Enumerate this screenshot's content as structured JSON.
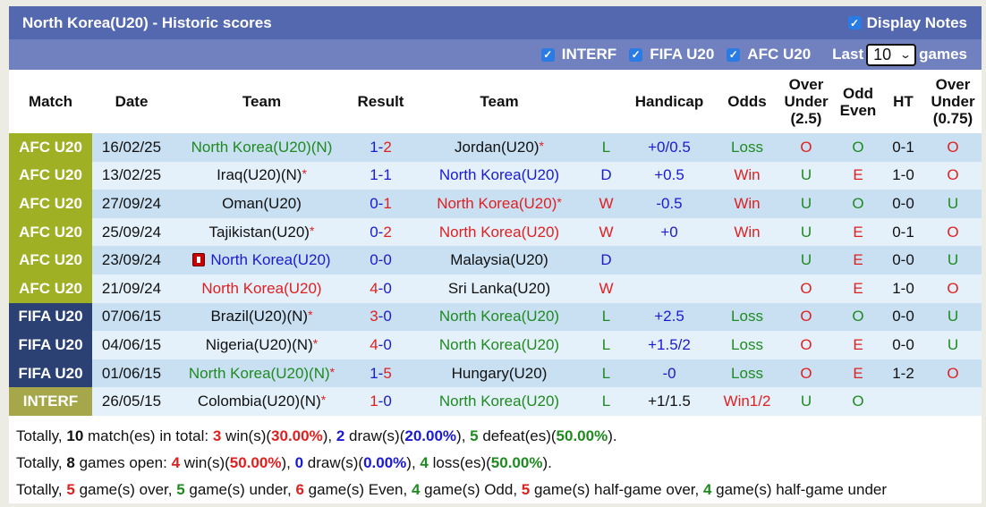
{
  "header": {
    "title": "North Korea(U20) - Historic scores",
    "display_notes_label": "Display Notes",
    "display_notes_checked": true
  },
  "filters": {
    "items": [
      {
        "label": "INTERF",
        "checked": true
      },
      {
        "label": "FIFA U20",
        "checked": true
      },
      {
        "label": "AFC U20",
        "checked": true
      }
    ],
    "last_label": "Last",
    "last_value": "10",
    "games_label": "games"
  },
  "columns": {
    "match": "Match",
    "date": "Date",
    "team_home": "Team",
    "result": "Result",
    "team_away": "Team",
    "handicap": "Handicap",
    "odds": "Odds",
    "over_under_l1": "Over",
    "over_under_l2": "Under",
    "over_under_l3": "(2.5)",
    "odd_even_l1": "Odd",
    "odd_even_l2": "Even",
    "ht": "HT",
    "ou2_l1": "Over",
    "ou2_l2": "Under",
    "ou2_l3": "(0.75)"
  },
  "rows": [
    {
      "league": "AFC U20",
      "league_type": "afc",
      "date": "16/02/25",
      "home": "North Korea(U20)(N)",
      "home_color": "green",
      "home_star": false,
      "home_card": false,
      "home_plain_suffix": "",
      "score_h": "1",
      "score_a": "2",
      "score_h_color": "blue",
      "score_a_color": "red",
      "away": "Jordan(U20)",
      "away_color": "black",
      "away_star": true,
      "outcome": "L",
      "outcome_color": "green",
      "handicap": "+0/0.5",
      "handicap_color": "blue",
      "odds": "Loss",
      "odds_color": "green",
      "ou": "O",
      "ou_color": "red",
      "oe": "O",
      "oe_color": "green",
      "ht": "0-1",
      "ou2": "O",
      "ou2_color": "red"
    },
    {
      "league": "AFC U20",
      "league_type": "afc",
      "date": "13/02/25",
      "home": "Iraq(U20)(N)",
      "home_color": "black",
      "home_star": true,
      "home_card": false,
      "score_h": "1",
      "score_a": "1",
      "score_h_color": "blue",
      "score_a_color": "blue",
      "away": "North Korea(U20)",
      "away_color": "blue",
      "away_star": false,
      "outcome": "D",
      "outcome_color": "blue",
      "handicap": "+0.5",
      "handicap_color": "blue",
      "odds": "Win",
      "odds_color": "red",
      "ou": "U",
      "ou_color": "green",
      "oe": "E",
      "oe_color": "red",
      "ht": "1-0",
      "ou2": "O",
      "ou2_color": "red"
    },
    {
      "league": "AFC U20",
      "league_type": "afc",
      "date": "27/09/24",
      "home": "Oman(U20)",
      "home_color": "black",
      "home_star": false,
      "home_card": false,
      "score_h": "0",
      "score_a": "1",
      "score_h_color": "blue",
      "score_a_color": "red",
      "away": "North Korea(U20)",
      "away_color": "red",
      "away_star": true,
      "outcome": "W",
      "outcome_color": "red",
      "handicap": "-0.5",
      "handicap_color": "blue",
      "odds": "Win",
      "odds_color": "red",
      "ou": "U",
      "ou_color": "green",
      "oe": "O",
      "oe_color": "green",
      "ht": "0-0",
      "ou2": "U",
      "ou2_color": "green"
    },
    {
      "league": "AFC U20",
      "league_type": "afc",
      "date": "25/09/24",
      "home": "Tajikistan(U20)",
      "home_color": "black",
      "home_star": true,
      "home_card": false,
      "score_h": "0",
      "score_a": "2",
      "score_h_color": "blue",
      "score_a_color": "red",
      "away": "North Korea(U20)",
      "away_color": "red",
      "away_star": false,
      "outcome": "W",
      "outcome_color": "red",
      "handicap": "+0",
      "handicap_color": "blue",
      "odds": "Win",
      "odds_color": "red",
      "ou": "U",
      "ou_color": "green",
      "oe": "E",
      "oe_color": "red",
      "ht": "0-1",
      "ou2": "O",
      "ou2_color": "red"
    },
    {
      "league": "AFC U20",
      "league_type": "afc",
      "date": "23/09/24",
      "home": "North Korea(U20)",
      "home_color": "blue",
      "home_star": false,
      "home_card": true,
      "score_h": "0",
      "score_a": "0",
      "score_h_color": "blue",
      "score_a_color": "blue",
      "away": "Malaysia(U20)",
      "away_color": "black",
      "away_star": false,
      "outcome": "D",
      "outcome_color": "blue",
      "handicap": "",
      "handicap_color": "blue",
      "odds": "",
      "odds_color": "red",
      "ou": "U",
      "ou_color": "green",
      "oe": "E",
      "oe_color": "red",
      "ht": "0-0",
      "ou2": "U",
      "ou2_color": "green"
    },
    {
      "league": "AFC U20",
      "league_type": "afc",
      "date": "21/09/24",
      "home": "North Korea(U20)",
      "home_color": "red",
      "home_star": false,
      "home_card": false,
      "score_h": "4",
      "score_a": "0",
      "score_h_color": "red",
      "score_a_color": "blue",
      "away": "Sri Lanka(U20)",
      "away_color": "black",
      "away_star": false,
      "outcome": "W",
      "outcome_color": "red",
      "handicap": "",
      "handicap_color": "blue",
      "odds": "",
      "odds_color": "red",
      "ou": "O",
      "ou_color": "red",
      "oe": "E",
      "oe_color": "red",
      "ht": "1-0",
      "ou2": "O",
      "ou2_color": "red"
    },
    {
      "league": "FIFA U20",
      "league_type": "fifa",
      "date": "07/06/15",
      "home": "Brazil(U20)(N)",
      "home_color": "black",
      "home_star": true,
      "home_card": false,
      "score_h": "3",
      "score_a": "0",
      "score_h_color": "red",
      "score_a_color": "blue",
      "away": "North Korea(U20)",
      "away_color": "green",
      "away_star": false,
      "outcome": "L",
      "outcome_color": "green",
      "handicap": "+2.5",
      "handicap_color": "blue",
      "odds": "Loss",
      "odds_color": "green",
      "ou": "O",
      "ou_color": "red",
      "oe": "O",
      "oe_color": "green",
      "ht": "0-0",
      "ou2": "U",
      "ou2_color": "green"
    },
    {
      "league": "FIFA U20",
      "league_type": "fifa",
      "date": "04/06/15",
      "home": "Nigeria(U20)(N)",
      "home_color": "black",
      "home_star": true,
      "home_card": false,
      "score_h": "4",
      "score_a": "0",
      "score_h_color": "red",
      "score_a_color": "blue",
      "away": "North Korea(U20)",
      "away_color": "green",
      "away_star": false,
      "outcome": "L",
      "outcome_color": "green",
      "handicap": "+1.5/2",
      "handicap_color": "blue",
      "odds": "Loss",
      "odds_color": "green",
      "ou": "O",
      "ou_color": "red",
      "oe": "E",
      "oe_color": "red",
      "ht": "0-0",
      "ou2": "U",
      "ou2_color": "green"
    },
    {
      "league": "FIFA U20",
      "league_type": "fifa",
      "date": "01/06/15",
      "home": "North Korea(U20)(N)",
      "home_color": "green",
      "home_star": true,
      "home_card": false,
      "score_h": "1",
      "score_a": "5",
      "score_h_color": "blue",
      "score_a_color": "red",
      "away": "Hungary(U20)",
      "away_color": "black",
      "away_star": false,
      "outcome": "L",
      "outcome_color": "green",
      "handicap": "-0",
      "handicap_color": "blue",
      "odds": "Loss",
      "odds_color": "green",
      "ou": "O",
      "ou_color": "red",
      "oe": "E",
      "oe_color": "red",
      "ht": "1-2",
      "ou2": "O",
      "ou2_color": "red"
    },
    {
      "league": "INTERF",
      "league_type": "interf",
      "date": "26/05/15",
      "home": "Colombia(U20)(N)",
      "home_color": "black",
      "home_star": true,
      "home_card": false,
      "score_h": "1",
      "score_a": "0",
      "score_h_color": "red",
      "score_a_color": "blue",
      "away": "North Korea(U20)",
      "away_color": "green",
      "away_star": false,
      "outcome": "L",
      "outcome_color": "green",
      "handicap": "+1/1.5",
      "handicap_color": "black",
      "odds": "Win1/2",
      "odds_color": "red",
      "ou": "U",
      "ou_color": "green",
      "oe": "O",
      "oe_color": "green",
      "ht": "",
      "ou2": "",
      "ou2_color": "green"
    }
  ],
  "summary": [
    [
      {
        "t": "Totally, ",
        "c": "black",
        "b": false
      },
      {
        "t": "10",
        "c": "black",
        "b": true
      },
      {
        "t": " match(es) in total: ",
        "c": "black",
        "b": false
      },
      {
        "t": "3",
        "c": "red",
        "b": true
      },
      {
        "t": " win(s)(",
        "c": "black",
        "b": false
      },
      {
        "t": "30.00%",
        "c": "red",
        "b": true
      },
      {
        "t": "), ",
        "c": "black",
        "b": false
      },
      {
        "t": "2",
        "c": "blue",
        "b": true
      },
      {
        "t": " draw(s)(",
        "c": "black",
        "b": false
      },
      {
        "t": "20.00%",
        "c": "blue",
        "b": true
      },
      {
        "t": "), ",
        "c": "black",
        "b": false
      },
      {
        "t": "5",
        "c": "green",
        "b": true
      },
      {
        "t": " defeat(es)(",
        "c": "black",
        "b": false
      },
      {
        "t": "50.00%",
        "c": "green",
        "b": true
      },
      {
        "t": ").",
        "c": "black",
        "b": false
      }
    ],
    [
      {
        "t": "Totally, ",
        "c": "black",
        "b": false
      },
      {
        "t": "8",
        "c": "black",
        "b": true
      },
      {
        "t": " games open: ",
        "c": "black",
        "b": false
      },
      {
        "t": "4",
        "c": "red",
        "b": true
      },
      {
        "t": " win(s)(",
        "c": "black",
        "b": false
      },
      {
        "t": "50.00%",
        "c": "red",
        "b": true
      },
      {
        "t": "), ",
        "c": "black",
        "b": false
      },
      {
        "t": "0",
        "c": "blue",
        "b": true
      },
      {
        "t": " draw(s)(",
        "c": "black",
        "b": false
      },
      {
        "t": "0.00%",
        "c": "blue",
        "b": true
      },
      {
        "t": "), ",
        "c": "black",
        "b": false
      },
      {
        "t": "4",
        "c": "green",
        "b": true
      },
      {
        "t": " loss(es)(",
        "c": "black",
        "b": false
      },
      {
        "t": "50.00%",
        "c": "green",
        "b": true
      },
      {
        "t": ").",
        "c": "black",
        "b": false
      }
    ],
    [
      {
        "t": "Totally, ",
        "c": "black",
        "b": false
      },
      {
        "t": "5",
        "c": "red",
        "b": true
      },
      {
        "t": " game(s) over, ",
        "c": "black",
        "b": false
      },
      {
        "t": "5",
        "c": "green",
        "b": true
      },
      {
        "t": " game(s) under, ",
        "c": "black",
        "b": false
      },
      {
        "t": "6",
        "c": "red",
        "b": true
      },
      {
        "t": " game(s) Even, ",
        "c": "black",
        "b": false
      },
      {
        "t": "4",
        "c": "green",
        "b": true
      },
      {
        "t": " game(s) Odd, ",
        "c": "black",
        "b": false
      },
      {
        "t": "5",
        "c": "red",
        "b": true
      },
      {
        "t": " game(s) half-game over, ",
        "c": "black",
        "b": false
      },
      {
        "t": "4",
        "c": "green",
        "b": true
      },
      {
        "t": " game(s) half-game under",
        "c": "black",
        "b": false
      }
    ]
  ]
}
